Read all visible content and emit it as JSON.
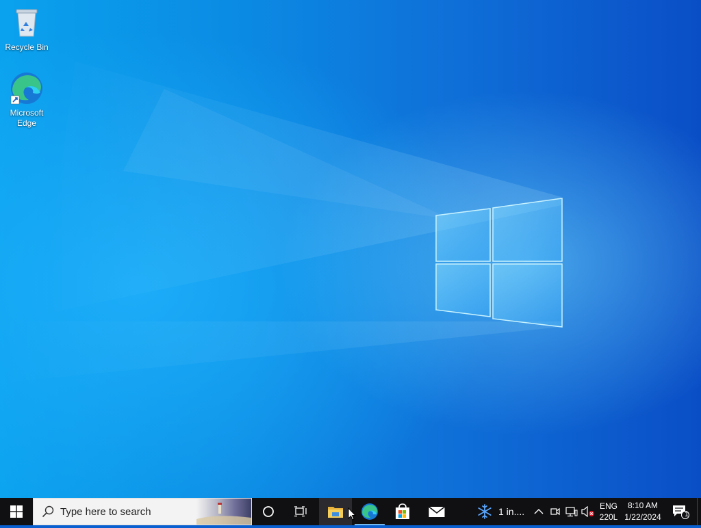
{
  "desktop": {
    "icons": [
      {
        "label": "Recycle Bin"
      },
      {
        "label": "Microsoft Edge"
      }
    ]
  },
  "taskbar": {
    "search_placeholder": "Type here to search",
    "weather_text": "1 in....",
    "language": "ENG",
    "keyboard": "220L",
    "time": "8:10 AM",
    "date": "1/22/2024",
    "notification_count": "1"
  },
  "colors": {
    "taskbar_bg": "#101013",
    "accent": "#76b9ed"
  }
}
